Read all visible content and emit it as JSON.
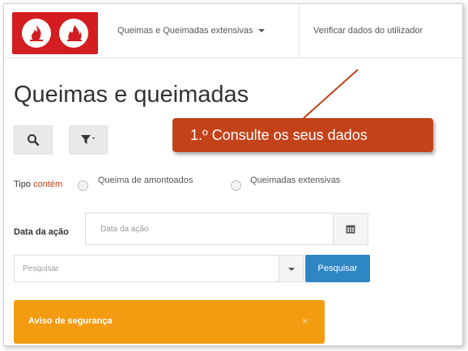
{
  "nav": {
    "queimas_menu": "Queimas e Queimadas extensivas",
    "verify_link": "Verificar dados do utilizador"
  },
  "page": {
    "title": "Queimas e queimadas"
  },
  "callout": {
    "text": "1.º Consulte os seus dados"
  },
  "filters": {
    "tipo_label": "Tipo",
    "tipo_op": "contém",
    "options": [
      "Queima de amontoados",
      "Queimadas extensivas"
    ]
  },
  "date": {
    "label": "Data da ação",
    "placeholder": "Data da ação"
  },
  "search": {
    "placeholder": "Pesquisar",
    "button": "Pesquisar"
  },
  "notice": {
    "text": "Aviso de segurança",
    "close": "×"
  },
  "colors": {
    "brand": "#d31d21",
    "callout": "#c3421a",
    "primary": "#2f86c4",
    "warning": "#f39c12"
  },
  "icons": {
    "logo": "fire-icon",
    "search": "search-icon",
    "filter": "filter-icon",
    "calendar": "calendar-icon"
  }
}
